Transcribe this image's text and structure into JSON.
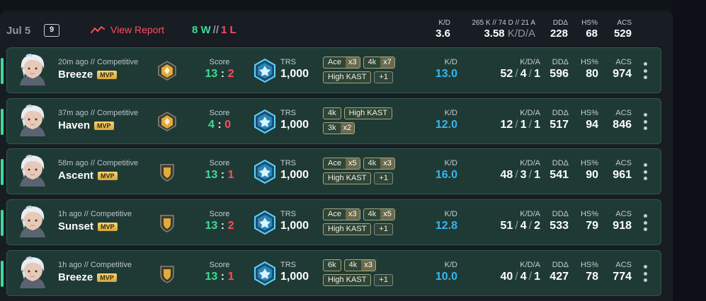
{
  "header": {
    "date": "Jul 5",
    "match_count": "9",
    "view_report": "View Report",
    "wins": "8 W",
    "sep": "//",
    "losses": "1 L",
    "kd_label": "K/D",
    "kd_value": "3.6",
    "kda_label": "265 K // 74 D // 21 A",
    "kda_value": "3.58",
    "kda_unit": "K/D/A",
    "dd_label": "DDΔ",
    "dd_value": "228",
    "hs_label": "HS%",
    "hs_value": "68",
    "acs_label": "ACS",
    "acs_value": "529"
  },
  "labels": {
    "score": "Score",
    "trs": "TRS",
    "kd": "K/D",
    "kda": "K/D/A",
    "dd": "DDΔ",
    "hs": "HS%",
    "acs": "ACS",
    "mvp": "MVP",
    "score_sep": ":",
    "kda_sep": "/"
  },
  "colors": {
    "win": "#3ddc97",
    "loss": "#ff4d5e",
    "kd_blue": "#35b6f0",
    "row_bg": "#1f3a35"
  },
  "matches": [
    {
      "ago": "20m ago // Competitive",
      "map": "Breeze",
      "rank_icon": "gold-diamond-rank-icon",
      "score_us": "13",
      "score_them": "2",
      "score_them_color": "r",
      "trs": "1,000",
      "badges_row1": [
        {
          "t": "Ace",
          "x": "x3"
        },
        {
          "t": "4k",
          "x": "x7"
        }
      ],
      "badges_row2": [
        {
          "t": "High KAST",
          "x": ""
        },
        {
          "t": "+1",
          "x": ""
        }
      ],
      "kd": "13.0",
      "k": "52",
      "d": "4",
      "a": "1",
      "dd": "596",
      "hs": "80",
      "acs": "974"
    },
    {
      "ago": "37m ago // Competitive",
      "map": "Haven",
      "rank_icon": "gold-diamond-rank-icon",
      "score_us": "4",
      "score_them": "0",
      "score_them_color": "r",
      "trs": "1,000",
      "badges_row1": [
        {
          "t": "4k",
          "x": ""
        },
        {
          "t": "High KAST",
          "x": ""
        }
      ],
      "badges_row2": [
        {
          "t": "3k",
          "x": "x2"
        }
      ],
      "kd": "12.0",
      "k": "12",
      "d": "1",
      "a": "1",
      "dd": "517",
      "hs": "94",
      "acs": "846"
    },
    {
      "ago": "58m ago // Competitive",
      "map": "Ascent",
      "rank_icon": "gold-shield-rank-icon",
      "score_us": "13",
      "score_them": "1",
      "score_them_color": "r",
      "trs": "1,000",
      "badges_row1": [
        {
          "t": "Ace",
          "x": "x5"
        },
        {
          "t": "4k",
          "x": "x3"
        }
      ],
      "badges_row2": [
        {
          "t": "High KAST",
          "x": ""
        },
        {
          "t": "+1",
          "x": ""
        }
      ],
      "kd": "16.0",
      "k": "48",
      "d": "3",
      "a": "1",
      "dd": "541",
      "hs": "90",
      "acs": "961"
    },
    {
      "ago": "1h ago // Competitive",
      "map": "Sunset",
      "rank_icon": "gold-shield-rank-icon",
      "score_us": "13",
      "score_them": "2",
      "score_them_color": "r",
      "trs": "1,000",
      "badges_row1": [
        {
          "t": "Ace",
          "x": "x3"
        },
        {
          "t": "4k",
          "x": "x5"
        }
      ],
      "badges_row2": [
        {
          "t": "High KAST",
          "x": ""
        },
        {
          "t": "+1",
          "x": ""
        }
      ],
      "kd": "12.8",
      "k": "51",
      "d": "4",
      "a": "2",
      "dd": "533",
      "hs": "79",
      "acs": "918"
    },
    {
      "ago": "1h ago // Competitive",
      "map": "Breeze",
      "rank_icon": "gold-shield-rank-icon",
      "score_us": "13",
      "score_them": "1",
      "score_them_color": "r",
      "trs": "1,000",
      "badges_row1": [
        {
          "t": "6k",
          "x": ""
        },
        {
          "t": "4k",
          "x": "x3"
        }
      ],
      "badges_row2": [
        {
          "t": "High KAST",
          "x": ""
        },
        {
          "t": "+1",
          "x": ""
        }
      ],
      "kd": "10.0",
      "k": "40",
      "d": "4",
      "a": "1",
      "dd": "427",
      "hs": "78",
      "acs": "774"
    }
  ]
}
